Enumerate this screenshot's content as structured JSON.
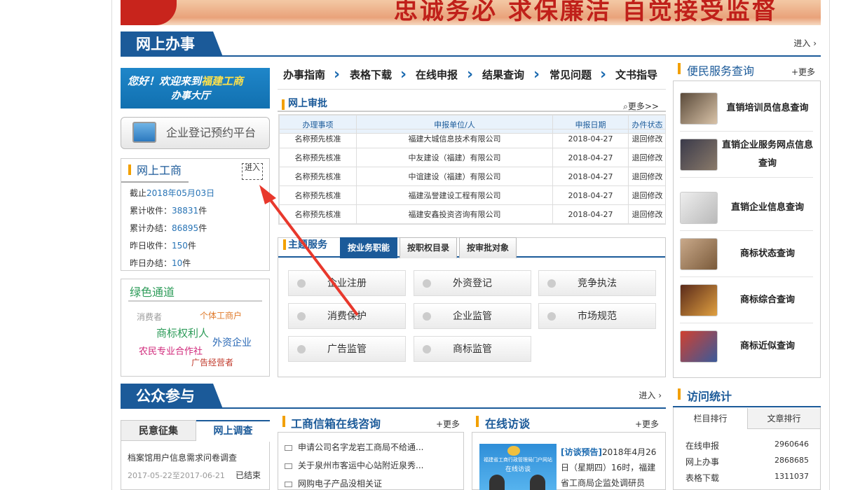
{
  "banner": {
    "text": "忠诚务必 求保廉洁 自觉接受监督"
  },
  "online_office": {
    "title": "网上办事",
    "more": "进入"
  },
  "welcome": {
    "line1_pre": "您好！欢迎来到",
    "line1_hl": "福建工商",
    "line2": "办事大厅"
  },
  "booking_button": "企业登记预约平台",
  "gongshang": {
    "title": "网上工商",
    "enter": "进入",
    "deadline_label": "截止",
    "deadline": "2018年05月03日",
    "stats": [
      {
        "label": "累计收件：",
        "value": "38831",
        "unit": "件"
      },
      {
        "label": "累计办结：",
        "value": "86895",
        "unit": "件"
      },
      {
        "label": "昨日收件：",
        "value": "150",
        "unit": "件"
      },
      {
        "label": "昨日办结：",
        "value": "10",
        "unit": "件"
      }
    ]
  },
  "green": {
    "title": "绿色通道",
    "tags": [
      "消费者",
      "个体工商户",
      "商标权利人",
      "外资企业",
      "农民专业合作社",
      "广告经营者"
    ],
    "tag_colors": [
      "#999999",
      "#e07a2a",
      "#2e9c5a",
      "#2b6ab6",
      "#d0277a",
      "#c0392b"
    ]
  },
  "nav": [
    "办事指南",
    "表格下载",
    "在线申报",
    "结果查询",
    "常见问题",
    "文书指导"
  ],
  "approval": {
    "title": "网上审批",
    "more": "更多>>",
    "headers": [
      "办理事项",
      "申报单位/人",
      "申报日期",
      "办件状态"
    ],
    "rows": [
      [
        "名称预先核准",
        "福建大城信息技术有限公司",
        "2018-04-27",
        "退回修改"
      ],
      [
        "名称预先核准",
        "中友建设（福建）有限公司",
        "2018-04-27",
        "退回修改"
      ],
      [
        "名称预先核准",
        "中谊建设（福建）有限公司",
        "2018-04-27",
        "退回修改"
      ],
      [
        "名称预先核准",
        "福建泓誉建设工程有限公司",
        "2018-04-27",
        "退回修改"
      ],
      [
        "名称预先核准",
        "福建安鑫投资咨询有限公司",
        "2018-04-27",
        "退回修改"
      ]
    ]
  },
  "theme": {
    "title": "主题服务",
    "tabs": [
      "按业务职能",
      "按职权目录",
      "按审批对象"
    ],
    "buttons": [
      "企业注册",
      "外资登记",
      "竞争执法",
      "消费保护",
      "企业监管",
      "市场规范",
      "广告监管",
      "商标监管"
    ]
  },
  "convenience": {
    "title": "便民服务查询",
    "more": "+更多",
    "items": [
      "直销培训员信息查询",
      "直销企业服务网点信息查询",
      "直销企业信息查询",
      "商标状态查询",
      "商标综合查询",
      "商标近似查询"
    ]
  },
  "public": {
    "title": "公众参与",
    "more": "进入"
  },
  "survey": {
    "tabs": [
      "民意征集",
      "网上调查"
    ],
    "item_title": "档案馆用户信息需求问卷调查",
    "item_date": "2017-05-22至2017-06-21",
    "item_status": "已结束"
  },
  "mailbox": {
    "title": "工商信箱在线咨询",
    "more": "+更多",
    "items": [
      "申请公司名字龙岩工商局不给通...",
      "关于泉州市客运中心站附近泉秀...",
      "网购电子产品没相关证"
    ]
  },
  "interview": {
    "title": "在线访谈",
    "more": "+更多",
    "tag": "[访谈预告]",
    "text": "2018年4月26日（星期四）16时，福建省工商局企监处调研员",
    "img_caption": "福建省工商行政管理局门户网站",
    "img_caption2": "在线访谈"
  },
  "visits": {
    "title": "访问统计",
    "tabs": [
      "栏目排行",
      "文章排行"
    ],
    "rows": [
      {
        "name": "在线申报",
        "count": "2960646"
      },
      {
        "name": "网上办事",
        "count": "2868685"
      },
      {
        "name": "表格下载",
        "count": "1311037"
      }
    ]
  }
}
